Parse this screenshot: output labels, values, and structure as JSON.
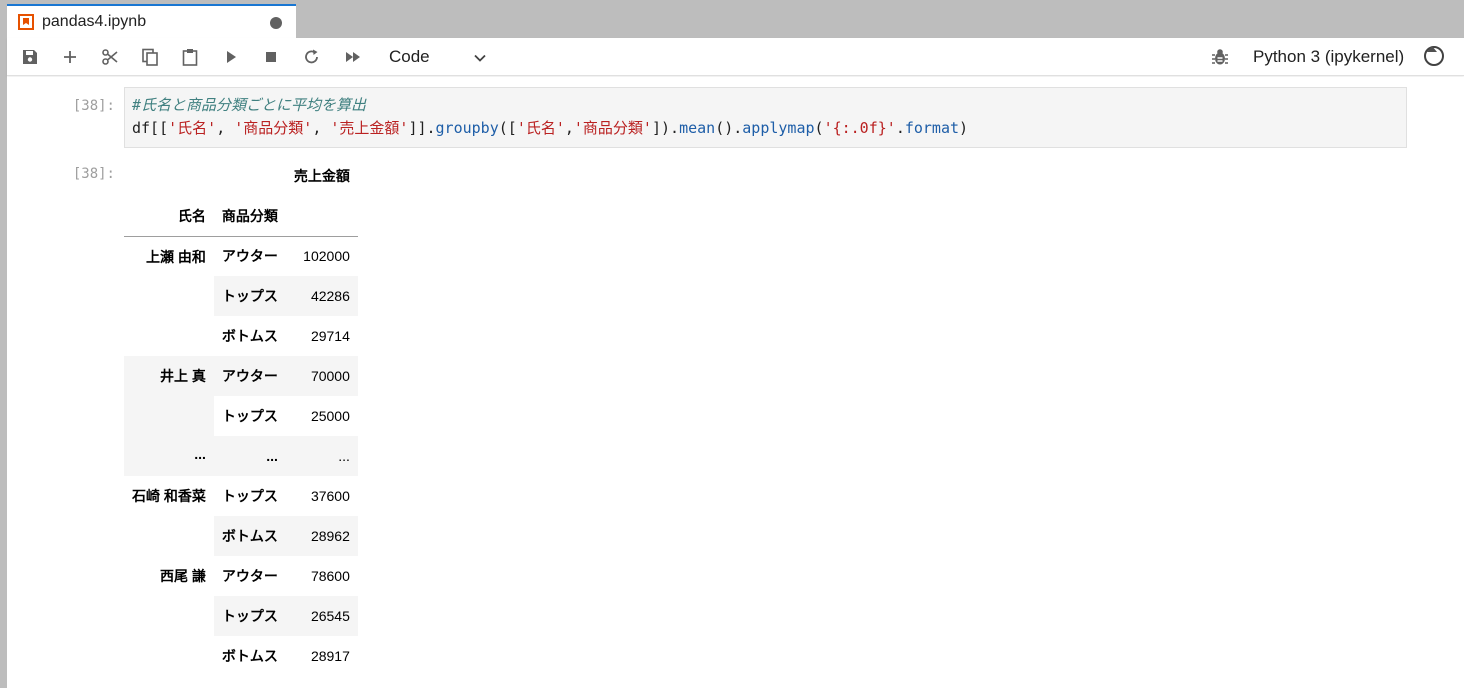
{
  "tab": {
    "title": "pandas4.ipynb"
  },
  "toolbar": {
    "cell_type": "Code",
    "kernel_name": "Python 3 (ipykernel)"
  },
  "cell": {
    "input_prompt": "[38]:",
    "output_prompt": "[38]:",
    "code_comment": "#氏名と商品分類ごとに平均を算出",
    "code": {
      "t1": "df[[",
      "s1": "'氏名'",
      "t2": ", ",
      "s2": "'商品分類'",
      "t3": ", ",
      "s3": "'売上金額'",
      "t4": "]].",
      "f1": "groupby",
      "t5": "([",
      "s4": "'氏名'",
      "t6": ",",
      "s5": "'商品分類'",
      "t7": "]).",
      "f2": "mean",
      "t8": "().",
      "f3": "applymap",
      "t9": "(",
      "s6": "'{:.0f}'",
      "t10": ".",
      "f4": "format",
      "t11": ")"
    }
  },
  "table": {
    "column_header": "売上金額",
    "index_names": [
      "氏名",
      "商品分類"
    ],
    "rows": [
      {
        "name": "上瀬 由和",
        "category": "アウター",
        "value": "102000"
      },
      {
        "name": "",
        "category": "トップス",
        "value": "42286"
      },
      {
        "name": "",
        "category": "ボトムス",
        "value": "29714"
      },
      {
        "name": "井上 真",
        "category": "アウター",
        "value": "70000"
      },
      {
        "name": "",
        "category": "トップス",
        "value": "25000"
      },
      {
        "name": "...",
        "category": "...",
        "value": "..."
      },
      {
        "name": "石崎 和香菜",
        "category": "トップス",
        "value": "37600"
      },
      {
        "name": "",
        "category": "ボトムス",
        "value": "28962"
      },
      {
        "name": "西尾 謙",
        "category": "アウター",
        "value": "78600"
      },
      {
        "name": "",
        "category": "トップス",
        "value": "26545"
      },
      {
        "name": "",
        "category": "ボトムス",
        "value": "28917"
      }
    ]
  },
  "icons": {
    "tab": "notebook-icon",
    "save": "save-icon",
    "add": "add-cell-icon",
    "cut": "cut-icon",
    "copy": "copy-icon",
    "paste": "paste-icon",
    "run": "run-icon",
    "stop": "stop-icon",
    "restart": "restart-icon",
    "run_all": "fast-forward-icon",
    "debugger": "bug-icon",
    "kernel_status": "kernel-idle-icon"
  }
}
